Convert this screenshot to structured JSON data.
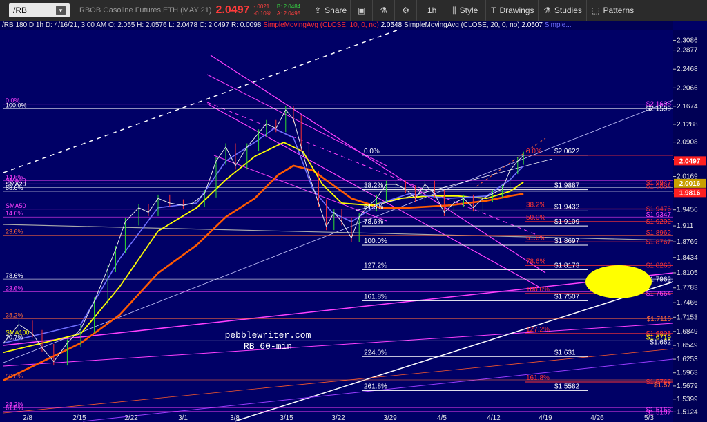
{
  "toolbar": {
    "symbol": "/RB",
    "description": "RBOB Gasoline Futures,ETH (MAY 21)",
    "last_price": "2.0497",
    "change": "-.0021",
    "change_pct": "-0.10%",
    "bid": "B: 2.0484",
    "ask": "A: 2.0495",
    "buttons": [
      {
        "label": "Share",
        "icon": "share-icon"
      },
      {
        "label": "",
        "icon": "layout-icon"
      },
      {
        "label": "",
        "icon": "flask-icon"
      },
      {
        "label": "",
        "icon": "gear-icon"
      },
      {
        "label": "1h",
        "icon": ""
      },
      {
        "label": "Style",
        "icon": "bars-icon"
      },
      {
        "label": "Drawings",
        "icon": "draw-icon"
      },
      {
        "label": "Studies",
        "icon": "flask-icon"
      },
      {
        "label": "Patterns",
        "icon": "pattern-icon"
      }
    ]
  },
  "infobar": {
    "symbol": "/RB 180 D 1h",
    "date": "D: 4/16/21, 3:00 AM",
    "open": "O: 2.055",
    "high": "H: 2.0576",
    "low": "L: 2.0478",
    "close": "C: 2.0497",
    "range": "R: 0.0098",
    "sma10_label": "SimpleMovingAvg (CLOSE, 10, 0, no)",
    "sma10_value": "2.0548",
    "sma20_label": "SimpleMovingAvg (CLOSE, 20, 0, no)",
    "sma20_value": "2.0507",
    "sma_more": "Simple..."
  },
  "watermark": {
    "line1": "pebblewriter.com",
    "line2": "RB 60-min"
  },
  "colors": {
    "background": "#000066",
    "white": "#ffffff",
    "magenta": "#ff40ff",
    "red_label": "#ff3333",
    "orange": "#ff6a00",
    "yellow": "#ffff00",
    "blue": "#6f6fff",
    "price_tag": "#ff2020",
    "highlight": "#ffff00"
  },
  "chart_data": {
    "type": "line",
    "y_axis": {
      "min": 1.51,
      "max": 2.33,
      "ticks": [
        "2.3086",
        "2.2877",
        "2.2468",
        "2.2066",
        "2.1674",
        "2.1288",
        "2.0908",
        "2.0536",
        "2.0169",
        "1.9811",
        "1.9456",
        "1.911",
        "1.8769",
        "1.8434",
        "1.8105",
        "1.7783",
        "1.7466",
        "1.7153",
        "1.6849",
        "1.6549",
        "1.6253",
        "1.5963",
        "1.5679",
        "1.5399",
        "1.5124"
      ]
    },
    "x_axis": {
      "ticks": [
        "2/8",
        "2/15",
        "2/22",
        "3/1",
        "3/8",
        "3/15",
        "3/22",
        "3/29",
        "4/5",
        "4/12",
        "4/19",
        "4/26",
        "5/3"
      ]
    },
    "price_tags": [
      {
        "label": "2.0497",
        "price": 2.0497,
        "color": "#ff2020"
      },
      {
        "label": "2.0016",
        "price": 2.0016,
        "color": "#c8a000"
      },
      {
        "label": "1.9816",
        "price": 1.9816,
        "color": "#ff2020"
      }
    ],
    "price_series": [
      [
        0,
        1.66
      ],
      [
        8,
        1.7
      ],
      [
        15,
        1.68
      ],
      [
        20,
        1.65
      ],
      [
        26,
        1.62
      ],
      [
        33,
        1.66
      ],
      [
        40,
        1.69
      ],
      [
        47,
        1.75
      ],
      [
        54,
        1.82
      ],
      [
        58,
        1.86
      ],
      [
        63,
        1.92
      ],
      [
        70,
        1.95
      ],
      [
        75,
        1.94
      ],
      [
        80,
        1.97
      ],
      [
        86,
        1.96
      ],
      [
        93,
        1.955
      ],
      [
        98,
        1.96
      ],
      [
        104,
        1.98
      ],
      [
        110,
        2.05
      ],
      [
        115,
        2.08
      ],
      [
        120,
        2.04
      ],
      [
        126,
        2.08
      ],
      [
        132,
        2.11
      ],
      [
        136,
        2.13
      ],
      [
        141,
        2.12
      ],
      [
        146,
        2.16
      ],
      [
        150,
        2.14
      ],
      [
        154,
        2.08
      ],
      [
        158,
        2.02
      ],
      [
        163,
        1.96
      ],
      [
        167,
        1.91
      ],
      [
        171,
        1.94
      ],
      [
        175,
        1.92
      ],
      [
        180,
        1.885
      ],
      [
        184,
        1.93
      ],
      [
        188,
        1.95
      ],
      [
        193,
        1.97
      ],
      [
        198,
        2.0
      ],
      [
        203,
        2.0
      ],
      [
        208,
        1.99
      ],
      [
        213,
        1.97
      ],
      [
        218,
        2.0
      ],
      [
        223,
        1.98
      ],
      [
        228,
        1.94
      ],
      [
        233,
        1.96
      ],
      [
        238,
        1.97
      ],
      [
        243,
        1.95
      ],
      [
        248,
        1.97
      ],
      [
        253,
        1.98
      ],
      [
        258,
        1.99
      ],
      [
        262,
        2.03
      ],
      [
        266,
        2.05
      ],
      [
        269,
        2.062
      ]
    ],
    "sma10": [
      [
        0,
        1.66
      ],
      [
        20,
        1.68
      ],
      [
        40,
        1.7
      ],
      [
        60,
        1.84
      ],
      [
        80,
        1.95
      ],
      [
        100,
        1.96
      ],
      [
        115,
        2.05
      ],
      [
        130,
        2.09
      ],
      [
        140,
        2.12
      ],
      [
        150,
        2.1
      ],
      [
        160,
        1.99
      ],
      [
        170,
        1.94
      ],
      [
        180,
        1.92
      ],
      [
        195,
        1.96
      ],
      [
        210,
        1.98
      ],
      [
        230,
        1.97
      ],
      [
        250,
        1.975
      ],
      [
        262,
        2.01
      ],
      [
        269,
        2.04
      ]
    ],
    "sma20": [
      [
        0,
        1.64
      ],
      [
        20,
        1.66
      ],
      [
        40,
        1.68
      ],
      [
        60,
        1.78
      ],
      [
        80,
        1.9
      ],
      [
        100,
        1.95
      ],
      [
        115,
        2.01
      ],
      [
        130,
        2.06
      ],
      [
        145,
        2.09
      ],
      [
        155,
        2.07
      ],
      [
        165,
        2.0
      ],
      [
        175,
        1.96
      ],
      [
        190,
        1.955
      ],
      [
        205,
        1.97
      ],
      [
        220,
        1.975
      ],
      [
        235,
        1.975
      ],
      [
        250,
        1.97
      ],
      [
        262,
        1.985
      ],
      [
        269,
        2.005
      ]
    ],
    "sma50": [
      [
        0,
        1.58
      ],
      [
        20,
        1.62
      ],
      [
        40,
        1.66
      ],
      [
        60,
        1.72
      ],
      [
        80,
        1.81
      ],
      [
        100,
        1.87
      ],
      [
        115,
        1.93
      ],
      [
        130,
        1.97
      ],
      [
        142,
        2.02
      ],
      [
        150,
        2.04
      ],
      [
        160,
        2.03
      ],
      [
        170,
        2.0
      ],
      [
        180,
        1.97
      ],
      [
        195,
        1.95
      ],
      [
        210,
        1.95
      ],
      [
        230,
        1.955
      ],
      [
        250,
        1.965
      ],
      [
        262,
        1.975
      ],
      [
        269,
        1.98
      ]
    ],
    "fib_levels": [
      {
        "pct": "0.0%",
        "price_label": "$2.0622",
        "price": 2.0622
      },
      {
        "pct": "38.2%",
        "price_label": "$1.9887",
        "price": 1.9887
      },
      {
        "pct": "61.8%",
        "price_label": "$1.9432",
        "price": 1.9432
      },
      {
        "pct": "78.6%",
        "price_label": "$1.9109",
        "price": 1.9109
      },
      {
        "pct": "100.0%",
        "price_label": "$1.8697",
        "price": 1.8697
      },
      {
        "pct": "127.2%",
        "price_label": "$1.8173",
        "price": 1.8173
      },
      {
        "pct": "161.8%",
        "price_label": "$1.7507",
        "price": 1.7507
      },
      {
        "pct": "224.0%",
        "price_label": "$1.631",
        "price": 1.631
      },
      {
        "pct": "261.8%",
        "price_label": "$1.5582",
        "price": 1.5582
      }
    ],
    "red_fib_levels": [
      {
        "pct": "0.0%",
        "price_label": "$2.0622",
        "price": 2.0622
      },
      {
        "pct": "38.2%",
        "price_label": "$1.9476",
        "price": 1.9476
      },
      {
        "pct": "50.0%",
        "price_label": "$1.9202",
        "price": 1.9202
      },
      {
        "pct": "61.8%",
        "price_label": "$1.8767",
        "price": 1.8767
      },
      {
        "pct": "78.6%",
        "price_label": "$1.8263",
        "price": 1.8263
      },
      {
        "pct": "100.0%",
        "price_label": "$1.7664",
        "price": 1.7664
      },
      {
        "pct": "127.2%",
        "price_label": "$1.6805",
        "price": 1.6805
      },
      {
        "pct": "161.8%",
        "price_label": "$1.5766",
        "price": 1.5766
      }
    ],
    "left_labels": [
      {
        "text": "0.0%",
        "price": 2.172,
        "color": "#ff40ff"
      },
      {
        "text": "100.0%",
        "price": 2.162,
        "color": "#ffffff"
      },
      {
        "text": "14.6%",
        "price": 2.008,
        "color": "#ff40ff"
      },
      {
        "text": "SMA10",
        "price": 2.001,
        "color": "#ff40ff"
      },
      {
        "text": "SMA20",
        "price": 1.993,
        "color": "#ffffff"
      },
      {
        "text": "88.6%",
        "price": 1.985,
        "color": "#ffffff"
      },
      {
        "text": "SMA50",
        "price": 1.947,
        "color": "#ff40ff"
      },
      {
        "text": "14.6%",
        "price": 1.93,
        "color": "#ff40ff"
      },
      {
        "text": "23.6%",
        "price": 1.891,
        "color": "#ff6a3a"
      },
      {
        "text": "78.6%",
        "price": 1.797,
        "color": "#ffffff"
      },
      {
        "text": "23.6%",
        "price": 1.77,
        "color": "#ff40ff"
      },
      {
        "text": "38.2%",
        "price": 1.712,
        "color": "#ff6a3a"
      },
      {
        "text": "SMA100",
        "price": 1.675,
        "color": "#ffff00"
      },
      {
        "text": "70.7%",
        "price": 1.665,
        "color": "#ffffff"
      },
      {
        "text": "50.0%",
        "price": 1.581,
        "color": "#ff6a3a"
      },
      {
        "text": "38.2%",
        "price": 1.521,
        "color": "#ff40ff"
      },
      {
        "text": "61.8%",
        "price": 1.514,
        "color": "#ff40ff"
      }
    ],
    "right_labels": [
      {
        "text": "$2.1698",
        "price": 2.172,
        "color": "#ff40ff"
      },
      {
        "text": "$2.1599",
        "price": 2.162,
        "color": "#ffffff"
      },
      {
        "text": "$1.9947",
        "price": 2.003,
        "color": "#ff3333"
      },
      {
        "text": "$1.9884",
        "price": 1.996,
        "color": "#ff3333"
      },
      {
        "text": "$1.9476",
        "price": 1.9476,
        "color": "#ff3333"
      },
      {
        "text": "$1.9347",
        "price": 1.9347,
        "color": "#ff40ff"
      },
      {
        "text": "$1.9202",
        "price": 1.9202,
        "color": "#ff3333"
      },
      {
        "text": "$1.8962",
        "price": 1.8962,
        "color": "#ff3333"
      },
      {
        "text": "$1.8767",
        "price": 1.8767,
        "color": "#ff3333"
      },
      {
        "text": "$1.8263",
        "price": 1.8263,
        "color": "#ff3333"
      },
      {
        "text": "$1.7962",
        "price": 1.7962,
        "color": "#ffffff"
      },
      {
        "text": "$1.7664",
        "price": 1.7664,
        "color": "#ff40ff"
      },
      {
        "text": "$1.7116",
        "price": 1.7116,
        "color": "#ff6a3a"
      },
      {
        "text": "$1.6805",
        "price": 1.6805,
        "color": "#ff3333"
      },
      {
        "text": "$1.6719",
        "price": 1.6719,
        "color": "#ffff00"
      },
      {
        "text": "$1.662",
        "price": 1.662,
        "color": "#ffffff"
      },
      {
        "text": "$1.5766",
        "price": 1.5766,
        "color": "#ff3333"
      },
      {
        "text": "$1.57",
        "price": 1.57,
        "color": "#ff6a3a"
      },
      {
        "text": "$1.5168",
        "price": 1.5168,
        "color": "#ff40ff"
      },
      {
        "text": "$1.5107",
        "price": 1.5107,
        "color": "#ff40ff"
      }
    ]
  }
}
